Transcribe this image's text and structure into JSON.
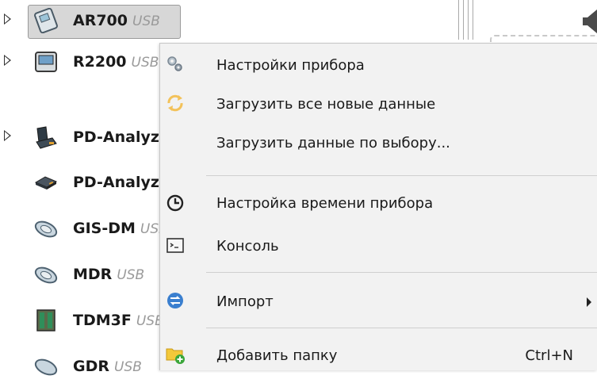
{
  "tree": {
    "items": [
      {
        "name": "AR700",
        "conn": "USB",
        "expandable": true,
        "selected": true,
        "icon": "ar700-device-icon"
      },
      {
        "name": "R2200",
        "conn": "USB",
        "expandable": true,
        "selected": false,
        "icon": "r2200-device-icon"
      },
      {
        "name": "PD-Analyzer",
        "conn": "",
        "expandable": true,
        "selected": false,
        "icon": "pd-analyzer-device-icon"
      },
      {
        "name": "PD-Analyzer",
        "conn": "",
        "expandable": false,
        "selected": false,
        "icon": "pd-analyzer-sensor-icon"
      },
      {
        "name": "GIS-DM",
        "conn": "USB",
        "expandable": false,
        "selected": false,
        "icon": "gis-dm-device-icon"
      },
      {
        "name": "MDR",
        "conn": "USB",
        "expandable": false,
        "selected": false,
        "icon": "mdr-device-icon"
      },
      {
        "name": "TDM3F",
        "conn": "USB",
        "expandable": false,
        "selected": false,
        "icon": "tdm3f-device-icon"
      },
      {
        "name": "GDR",
        "conn": "USB",
        "expandable": false,
        "selected": false,
        "icon": "gdr-device-icon"
      }
    ]
  },
  "context_menu": {
    "device_settings": "Настройки прибора",
    "load_all_new": "Загрузить все новые данные",
    "load_selected": "Загрузить данные по выбору...",
    "time_settings": "Настройка времени прибора",
    "console": "Консоль",
    "import": "Импорт",
    "add_folder": "Добавить папку",
    "add_folder_shortcut": "Ctrl+N"
  },
  "colors": {
    "menu_bg": "#f2f2f2",
    "selected_bg": "#d7d7d7",
    "connection_text": "#9a9a9a",
    "folder_icon": "#f3c83a",
    "add_badge": "#3aa63a",
    "import_icon": "#3a7fcf"
  }
}
